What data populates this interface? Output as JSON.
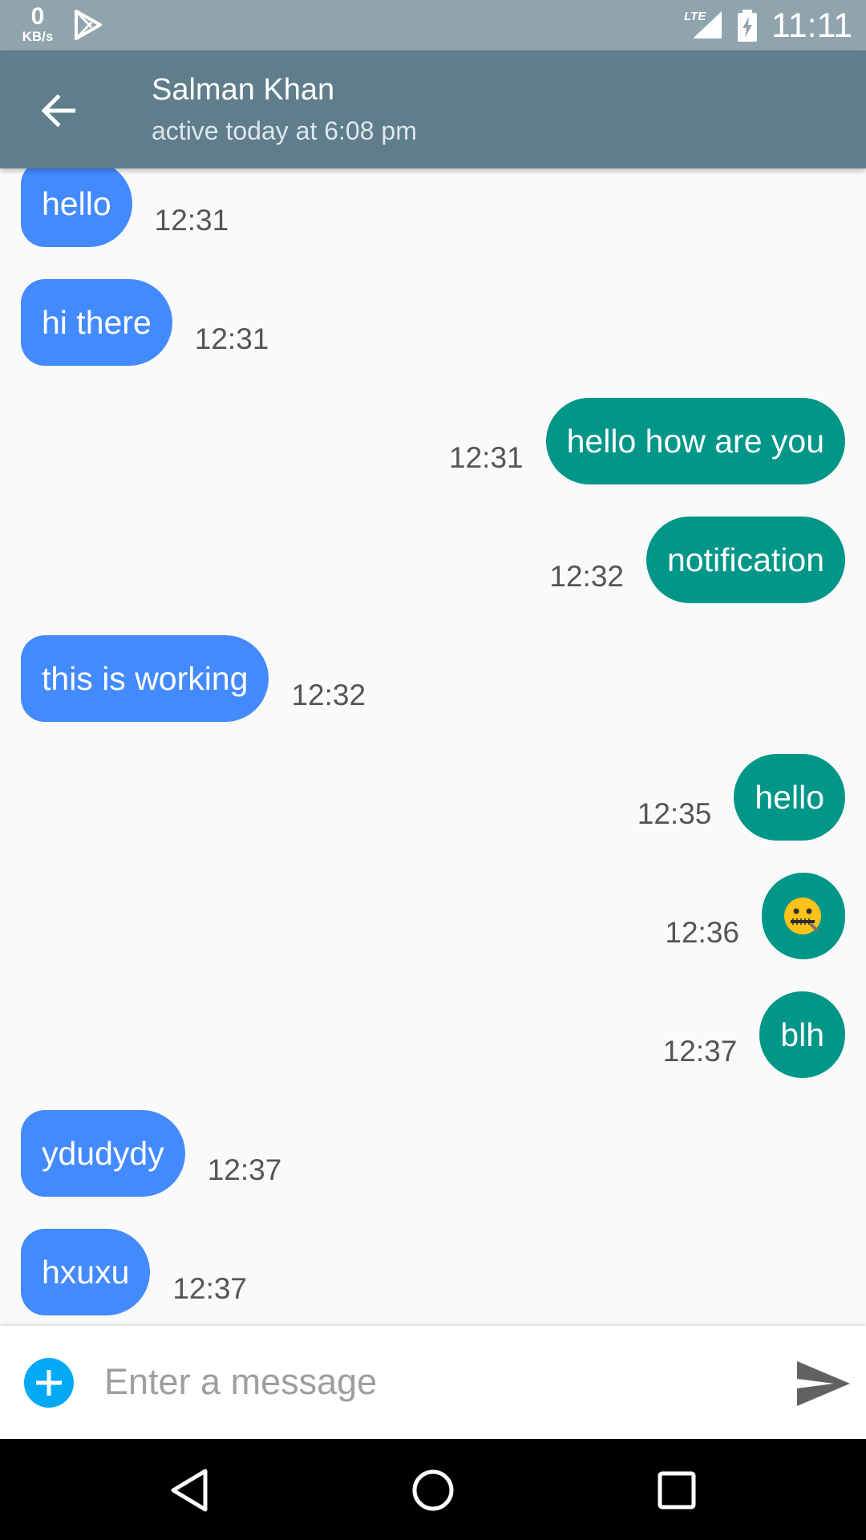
{
  "status_bar": {
    "net_speed_value": "0",
    "net_speed_unit": "KB/s",
    "network_type": "LTE",
    "time": "11:11",
    "icons": [
      "play-store-icon",
      "signal-icon",
      "battery-charging-icon"
    ]
  },
  "toolbar": {
    "contact_name": "Salman Khan",
    "contact_status": "active today at 6:08 pm",
    "background_color": "#607d8b"
  },
  "messages": [
    {
      "direction": "incoming",
      "text": "hello",
      "time": "12:31"
    },
    {
      "direction": "incoming",
      "text": "hi there",
      "time": "12:31"
    },
    {
      "direction": "outgoing",
      "text": "hello how are you",
      "time": "12:31"
    },
    {
      "direction": "outgoing",
      "text": "notification",
      "time": "12:32"
    },
    {
      "direction": "incoming",
      "text": "this is working",
      "time": "12:32"
    },
    {
      "direction": "outgoing",
      "text": "hello",
      "time": "12:35"
    },
    {
      "direction": "outgoing",
      "text": "zipper-mouth-face-emoji",
      "time": "12:36"
    },
    {
      "direction": "outgoing",
      "text": "blh",
      "time": "12:37"
    },
    {
      "direction": "incoming",
      "text": "ydudydy",
      "time": "12:37"
    },
    {
      "direction": "incoming",
      "text": "hxuxu",
      "time": "12:37"
    }
  ],
  "colors": {
    "incoming_bubble": "#448aff",
    "outgoing_bubble": "#009688",
    "status_bar": "#90a4ae"
  },
  "composer": {
    "placeholder": "Enter a message",
    "value": "",
    "attach_icon": "add-circle-icon",
    "send_icon": "send-icon"
  },
  "nav_bar": {
    "icons": [
      "nav-back-icon",
      "nav-home-icon",
      "nav-recents-icon"
    ]
  }
}
